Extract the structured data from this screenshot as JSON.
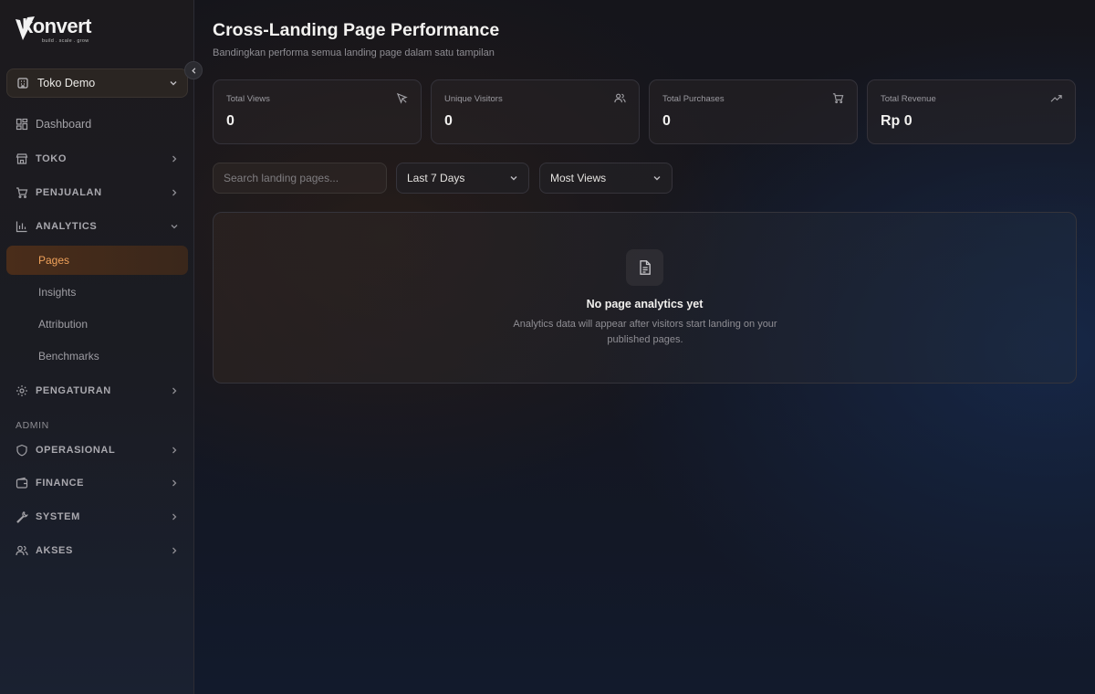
{
  "app": {
    "logo_text": "konvert",
    "logo_tagline": "build . scale . grow"
  },
  "colors": {
    "accent": "#f0a25a",
    "active_bg": "#4a2d1a"
  },
  "sidebar": {
    "store_selector": {
      "value": "Toko Demo",
      "icon": "store-icon"
    },
    "items": [
      {
        "label": "Dashboard",
        "icon": "dashboard-icon",
        "has_chevron": false
      },
      {
        "label": "TOKO",
        "icon": "store-icon",
        "has_chevron": true,
        "chevron": "right"
      },
      {
        "label": "PENJUALAN",
        "icon": "cart-icon",
        "has_chevron": true,
        "chevron": "right"
      },
      {
        "label": "ANALYTICS",
        "icon": "bar-chart-icon",
        "has_chevron": true,
        "chevron": "down",
        "expanded": true
      }
    ],
    "analytics_sub": [
      {
        "label": "Pages",
        "active": true
      },
      {
        "label": "Insights",
        "active": false
      },
      {
        "label": "Attribution",
        "active": false
      },
      {
        "label": "Benchmarks",
        "active": false
      }
    ],
    "settings": {
      "label": "PENGATURAN",
      "icon": "gear-icon"
    },
    "admin_label": "ADMIN",
    "admin_items": [
      {
        "label": "OPERASIONAL",
        "icon": "shield-icon"
      },
      {
        "label": "FINANCE",
        "icon": "wallet-icon"
      },
      {
        "label": "SYSTEM",
        "icon": "wrench-icon"
      },
      {
        "label": "AKSES",
        "icon": "users-icon"
      }
    ]
  },
  "header": {
    "title": "Cross-Landing Page Performance",
    "subtitle": "Bandingkan performa semua landing page dalam satu tampilan"
  },
  "stats": [
    {
      "label": "Total Views",
      "value": "0",
      "icon": "cursor-icon"
    },
    {
      "label": "Unique Visitors",
      "value": "0",
      "icon": "users-icon"
    },
    {
      "label": "Total Purchases",
      "value": "0",
      "icon": "cart-icon"
    },
    {
      "label": "Total Revenue",
      "value": "Rp 0",
      "icon": "trending-up-icon"
    }
  ],
  "filters": {
    "search_placeholder": "Search landing pages...",
    "search_value": "",
    "period": "Last 7 Days",
    "sort": "Most Views"
  },
  "empty_state": {
    "icon": "document-icon",
    "title": "No page analytics yet",
    "description": "Analytics data will appear after visitors start landing on your published pages."
  }
}
